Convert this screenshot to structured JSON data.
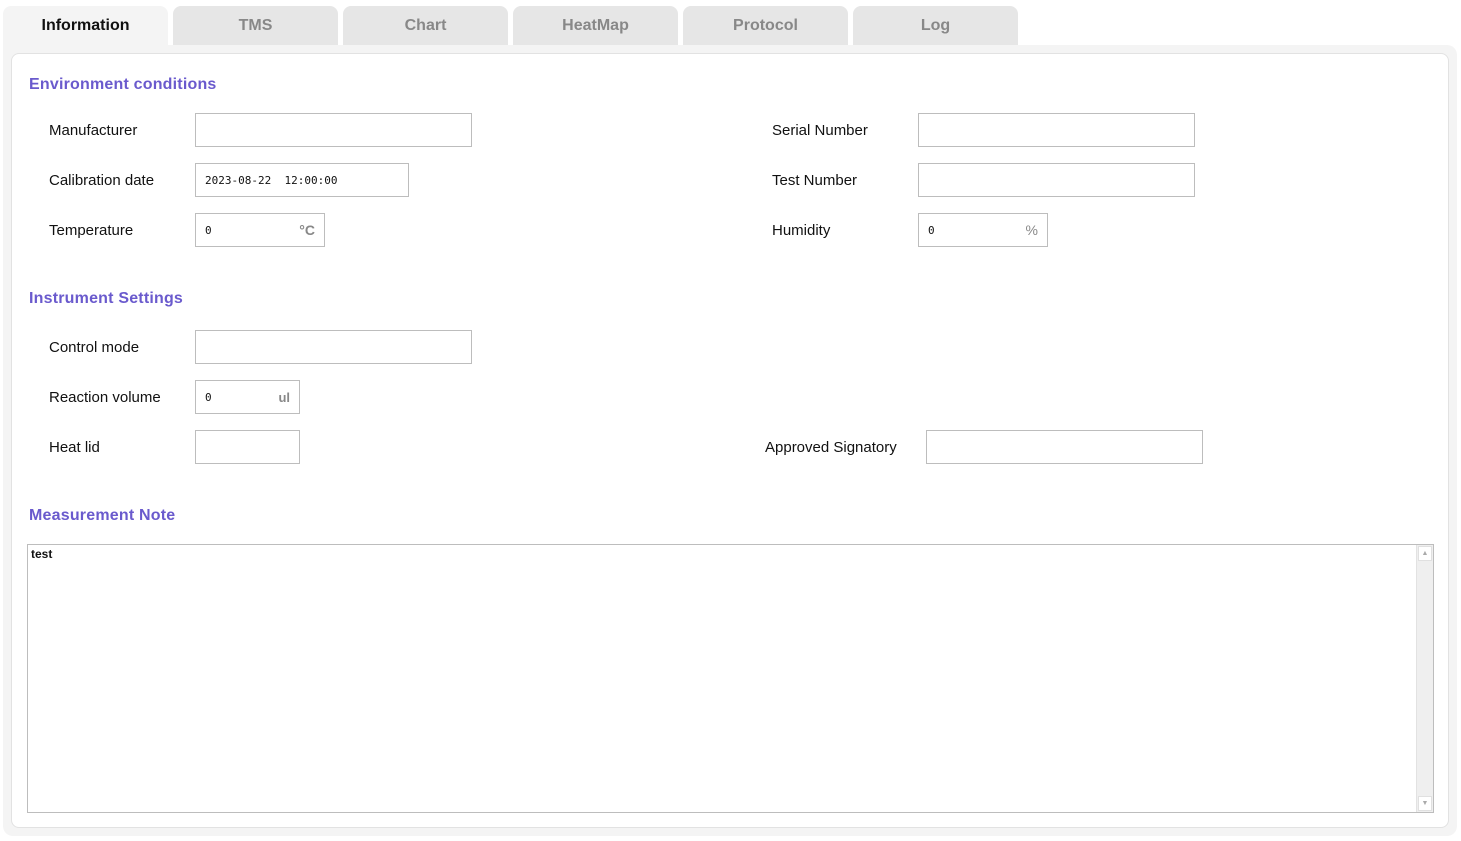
{
  "tabs": [
    {
      "label": "Information",
      "active": true
    },
    {
      "label": "TMS",
      "active": false
    },
    {
      "label": "Chart",
      "active": false
    },
    {
      "label": "HeatMap",
      "active": false
    },
    {
      "label": "Protocol",
      "active": false
    },
    {
      "label": "Log",
      "active": false
    }
  ],
  "environment": {
    "title": "Environment conditions",
    "manufacturer": {
      "label": "Manufacturer",
      "value": ""
    },
    "calibration_date": {
      "label": "Calibration date",
      "value": "2023-08-22  12:00:00"
    },
    "temperature": {
      "label": "Temperature",
      "value": "0",
      "unit": "°C"
    },
    "serial_number": {
      "label": "Serial Number",
      "value": ""
    },
    "test_number": {
      "label": "Test Number",
      "value": ""
    },
    "humidity": {
      "label": "Humidity",
      "value": "0",
      "unit": "%"
    }
  },
  "instrument": {
    "title": "Instrument Settings",
    "control_mode": {
      "label": "Control mode",
      "value": ""
    },
    "reaction_volume": {
      "label": "Reaction volume",
      "value": "0",
      "unit": "ul"
    },
    "heat_lid": {
      "label": "Heat lid",
      "value": ""
    },
    "approved_signatory": {
      "label": "Approved Signatory",
      "value": ""
    }
  },
  "measurement_note": {
    "title": "Measurement Note",
    "text": "test"
  },
  "icons": {
    "scroll_up": "▲",
    "scroll_down": "▼"
  }
}
